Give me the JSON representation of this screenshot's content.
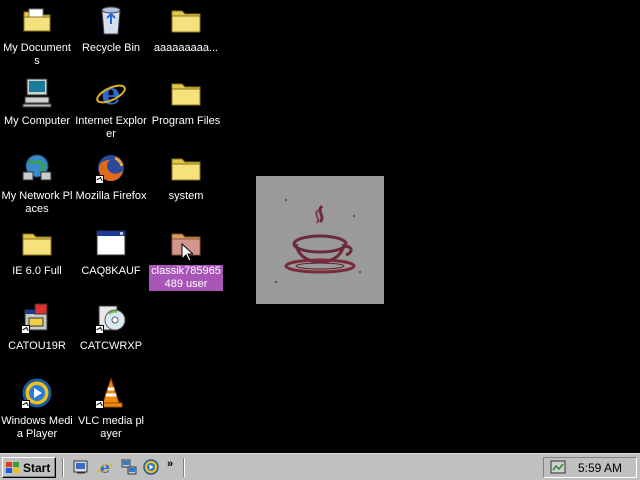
{
  "desktop_icons": [
    {
      "name": "my-documents",
      "label": "My Documents",
      "icon": "folder-documents-icon"
    },
    {
      "name": "recycle-bin",
      "label": "Recycle Bin",
      "icon": "recycle-bin-icon"
    },
    {
      "name": "folder-aaaa",
      "label": "aaaaaaaaa...",
      "icon": "folder-icon"
    },
    {
      "name": "my-computer",
      "label": "My Computer",
      "icon": "computer-icon"
    },
    {
      "name": "internet-explorer",
      "label": "Internet Explorer",
      "icon": "internet-explorer-icon"
    },
    {
      "name": "program-files",
      "label": "Program Files",
      "icon": "folder-icon"
    },
    {
      "name": "my-network-places",
      "label": "My Network Places",
      "icon": "network-icon"
    },
    {
      "name": "mozilla-firefox",
      "label": "Mozilla Firefox",
      "icon": "firefox-icon"
    },
    {
      "name": "system",
      "label": "system",
      "icon": "folder-icon"
    },
    {
      "name": "ie-6-full",
      "label": "IE 6.0 Full",
      "icon": "folder-icon"
    },
    {
      "name": "caq8kauf",
      "label": "CAQ8KAUF",
      "icon": "window-app-icon"
    },
    {
      "name": "classik-user",
      "label": "classik785965 489 user",
      "icon": "folder-icon",
      "selected": true
    },
    {
      "name": "catou19r",
      "label": "CATOU19R",
      "icon": "installer-icon"
    },
    {
      "name": "catcwrxp",
      "label": "CATCWRXP",
      "icon": "cd-installer-icon"
    },
    {
      "name": "windows-media-player",
      "label": "Windows Media Player",
      "icon": "media-player-icon"
    },
    {
      "name": "vlc-media-player",
      "label": "VLC media player",
      "icon": "vlc-cone-icon"
    }
  ],
  "wallpaper": {
    "icon": "java-coffee-cup-icon"
  },
  "taskbar": {
    "start_label": "Start",
    "quick_launch": [
      "show-desktop-icon",
      "internet-explorer-icon",
      "network-icon",
      "media-player-icon"
    ],
    "more_label": "»",
    "clock": "5:59 AM",
    "tray_icon": "volume-icon"
  },
  "colors": {
    "desktop": "#000000",
    "taskbar": "#c0c0c0",
    "selection": "#a855b8",
    "folder": "#f3e27a"
  }
}
